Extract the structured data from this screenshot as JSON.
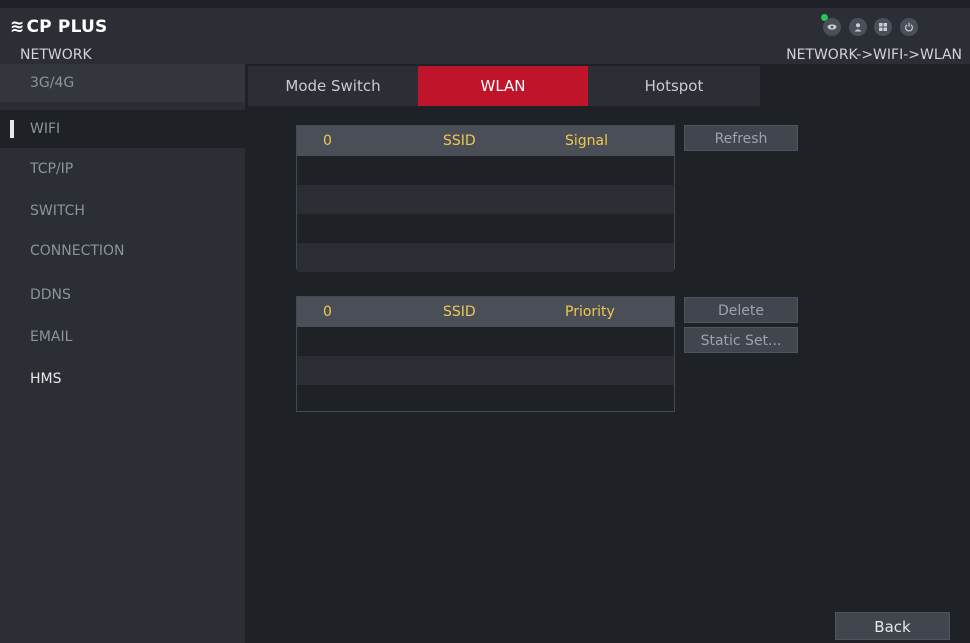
{
  "app": {
    "logo_text": "CP PLUS"
  },
  "header": {
    "title": "NETWORK",
    "breadcrumb": "NETWORK->WIFI->WLAN"
  },
  "sidebar": {
    "items": [
      {
        "label": "3G/4G"
      },
      {
        "label": "WIFI"
      },
      {
        "label": "TCP/IP"
      },
      {
        "label": "SWITCH"
      },
      {
        "label": "CONNECTION"
      },
      {
        "label": "DDNS"
      },
      {
        "label": "EMAIL"
      },
      {
        "label": "HMS"
      }
    ]
  },
  "tabs": [
    {
      "label": "Mode Switch"
    },
    {
      "label": "WLAN"
    },
    {
      "label": "Hotspot"
    }
  ],
  "wifi_table": {
    "columns": [
      "0",
      "SSID",
      "Signal"
    ],
    "rows": []
  },
  "saved_table": {
    "columns": [
      "0",
      "SSID",
      "Priority"
    ],
    "rows": []
  },
  "buttons": {
    "refresh": "Refresh",
    "delete": "Delete",
    "static_set": "Static Set...",
    "back": "Back"
  },
  "icons": {
    "top": [
      "eye-icon",
      "user-icon",
      "grid-icon",
      "power-icon"
    ],
    "accent": "#c0142a",
    "header_text": "#f0c850"
  }
}
